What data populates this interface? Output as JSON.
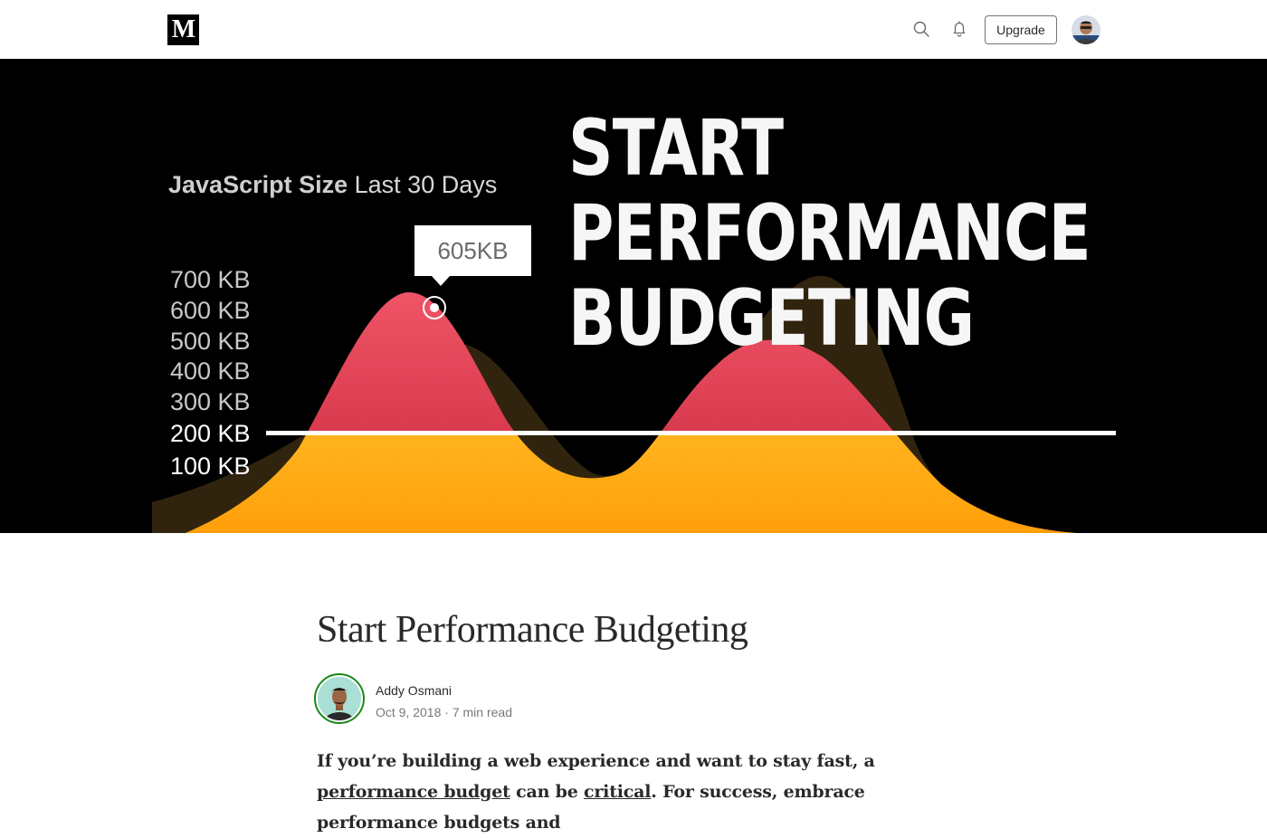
{
  "nav": {
    "logo_letter": "M",
    "upgrade_label": "Upgrade",
    "icons": [
      "search-icon",
      "bell-icon"
    ]
  },
  "hero": {
    "chart_title_bold": "JavaScript Size",
    "chart_title_rest": "Last 30 Days",
    "y_ticks": [
      "700 KB",
      "600 KB",
      "500 KB",
      "400 KB",
      "300 KB",
      "200 KB",
      "100 KB"
    ],
    "tooltip": "605KB",
    "heading_lines": [
      "START",
      "PERFORMANCE",
      "BUDGETING"
    ],
    "colors": {
      "background": "#000000",
      "over_budget": "#e0334b",
      "under_budget": "#ffb31a",
      "shadow_series": "#3a2a12",
      "budget_line": "#ffffff"
    }
  },
  "article": {
    "title": "Start Performance Budgeting",
    "author": "Addy Osmani",
    "date": "Oct 9, 2018",
    "separator": "·",
    "read_time": "7 min read",
    "body_intro": {
      "text_1": "If you’re building a web experience and want to stay fast, a ",
      "link_1": "performance budget",
      "text_2": " can be ",
      "link_2": "critical",
      "text_3": ". For success, embrace performance budgets and"
    }
  }
}
